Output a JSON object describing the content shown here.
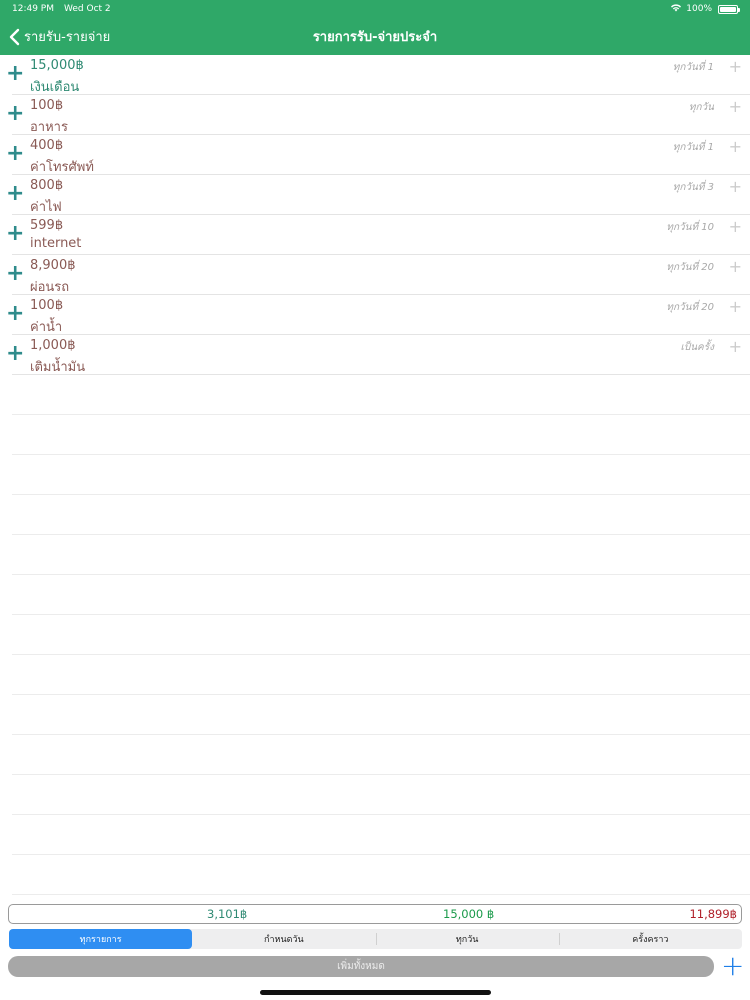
{
  "status_bar": {
    "time": "12:49 PM",
    "date": "Wed Oct 2",
    "battery": "100%"
  },
  "nav": {
    "back_label": "รายรับ-รายจ่าย",
    "title": "รายการรับ-จ่ายประจำ"
  },
  "items": [
    {
      "amount": "15,000฿",
      "name": "เงินเดือน",
      "frequency": "ทุกวันที่ 1",
      "kind": "income"
    },
    {
      "amount": "100฿",
      "name": "อาหาร",
      "frequency": "ทุกวัน",
      "kind": "expense"
    },
    {
      "amount": "400฿",
      "name": "ค่าโทรศัพท์",
      "frequency": "ทุกวันที่ 1",
      "kind": "expense"
    },
    {
      "amount": "800฿",
      "name": "ค่าไฟ",
      "frequency": "ทุกวันที่ 3",
      "kind": "expense"
    },
    {
      "amount": "599฿",
      "name": "internet",
      "frequency": "ทุกวันที่ 10",
      "kind": "expense"
    },
    {
      "amount": "8,900฿",
      "name": "ผ่อนรถ",
      "frequency": "ทุกวันที่ 20",
      "kind": "expense"
    },
    {
      "amount": "100฿",
      "name": "ค่าน้ำ",
      "frequency": "ทุกวันที่ 20",
      "kind": "expense"
    },
    {
      "amount": "1,000฿",
      "name": "เติมน้ำมัน",
      "frequency": "เป็นครั้ง",
      "kind": "expense"
    }
  ],
  "summary": {
    "left": "3,101฿",
    "middle": "15,000 ฿",
    "right": "11,899฿"
  },
  "filter_segments": [
    {
      "label": "ทุกรายการ",
      "active": true
    },
    {
      "label": "กำหนดวัน",
      "active": false
    },
    {
      "label": "ทุกวัน",
      "active": false
    },
    {
      "label": "ครั้งคราว",
      "active": false
    }
  ],
  "add_all_label": "เพิ่มทั้งหมด",
  "plus_label": "+",
  "colors": {
    "nav": "#2fa868",
    "income": "#2f8a73",
    "expense": "#8a5a55",
    "total_expense": "#b0202a",
    "accent": "#2f8ef2"
  }
}
